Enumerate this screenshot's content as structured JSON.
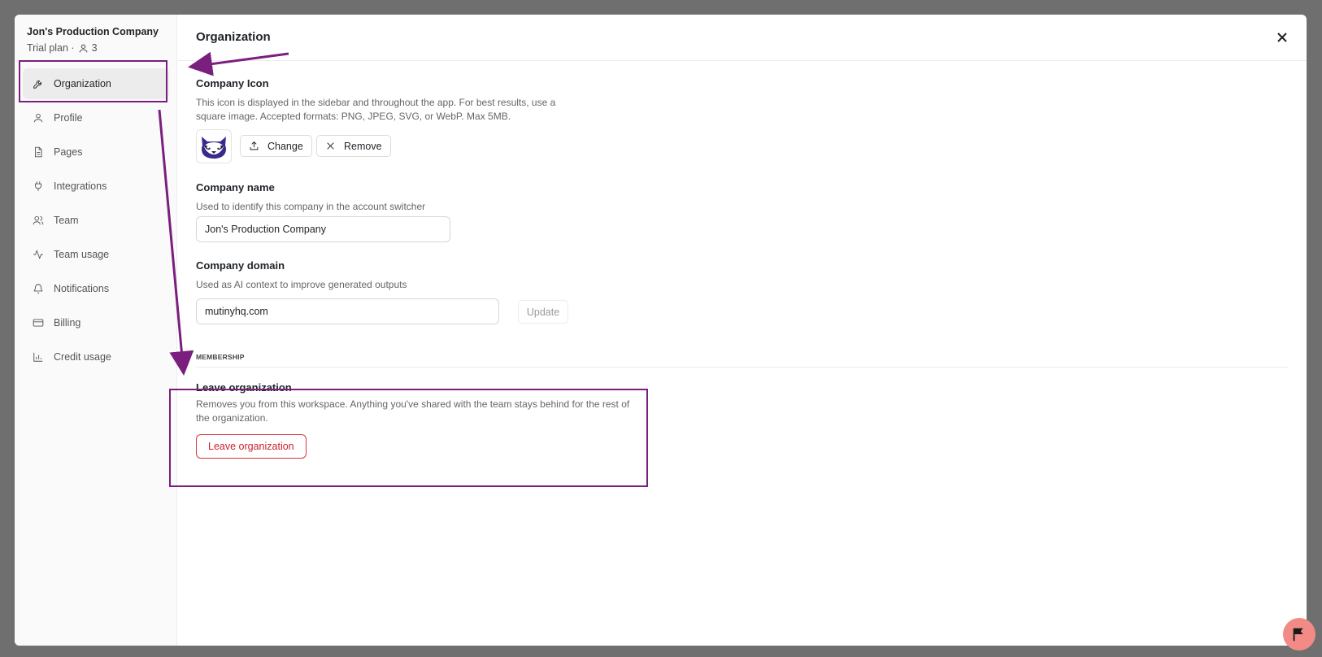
{
  "sidebar": {
    "org_name": "Jon's Production Company",
    "plan": "Trial plan ·",
    "member_count": "3",
    "items": [
      {
        "label": "Organization",
        "icon": "wrench-icon",
        "active": true
      },
      {
        "label": "Profile",
        "icon": "user-icon"
      },
      {
        "label": "Pages",
        "icon": "file-icon"
      },
      {
        "label": "Integrations",
        "icon": "plug-icon"
      },
      {
        "label": "Team",
        "icon": "users-icon"
      },
      {
        "label": "Team usage",
        "icon": "activity-icon"
      },
      {
        "label": "Notifications",
        "icon": "bell-icon"
      },
      {
        "label": "Billing",
        "icon": "credit-card-icon"
      },
      {
        "label": "Credit usage",
        "icon": "bar-chart-icon"
      }
    ]
  },
  "header": {
    "title": "Organization"
  },
  "company_icon": {
    "title": "Company Icon",
    "description_line1": "This icon is displayed in the sidebar and throughout the app. For best results, use a",
    "description_line2": "square image. Accepted formats: PNG, JPEG, SVG, or WebP. Max 5MB.",
    "change_label": "Change",
    "remove_label": "Remove"
  },
  "company_name": {
    "title": "Company name",
    "description": "Used to identify this company in the account switcher",
    "value": "Jon's Production Company"
  },
  "company_domain": {
    "title": "Company domain",
    "description": "Used as AI context to improve generated outputs",
    "value": "mutinyhq.com",
    "update_label": "Update"
  },
  "membership": {
    "heading": "MEMBERSHIP",
    "leave_title": "Leave organization",
    "leave_desc_line1": "Removes you from this workspace. Anything you've shared with the team stays behind for the rest of",
    "leave_desc_line2": "the organization.",
    "leave_button": "Leave organization"
  },
  "colors": {
    "annotation": "#7a1f7e",
    "danger": "#c8232c",
    "fab": "#f28b86"
  }
}
